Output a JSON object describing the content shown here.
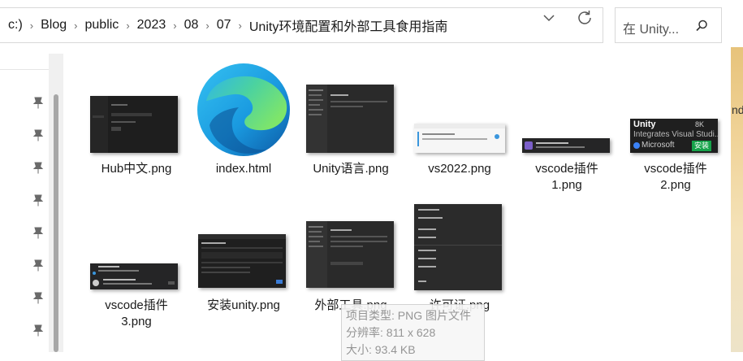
{
  "address": {
    "breadcrumbs": [
      "c:)",
      "Blog",
      "public",
      "2023",
      "08",
      "07",
      "Unity环境配置和外部工具食用指南"
    ],
    "separator": "›"
  },
  "search": {
    "placeholder": "在 Unity..."
  },
  "right_edge_text": "nd",
  "files": [
    {
      "name": "Hub中文.png"
    },
    {
      "name": "index.html"
    },
    {
      "name": "Unity语言.png"
    },
    {
      "name": "vs2022.png"
    },
    {
      "name": "vscode插件",
      "name2": "1.png"
    },
    {
      "name": "vscode插件",
      "name2": "2.png"
    },
    {
      "name": "vscode插件",
      "name2": "3.png"
    },
    {
      "name": "安装unity.png"
    },
    {
      "name": "外部工具.png"
    },
    {
      "name": "许可证.png"
    }
  ],
  "thumb_text": {
    "vscode2_title": "Unity",
    "vscode2_count": "8K",
    "vscode2_desc": "Integrates Visual Studi...",
    "vscode2_publisher": "Microsoft",
    "vscode2_install": "安装"
  },
  "tooltip": {
    "type": "项目类型: PNG 图片文件",
    "dimensions": "分辨率: 811 x 628",
    "size": "大小: 93.4 KB"
  },
  "colors": {
    "accent_green": "#16a34a",
    "folder_strip": "#e9c783"
  }
}
